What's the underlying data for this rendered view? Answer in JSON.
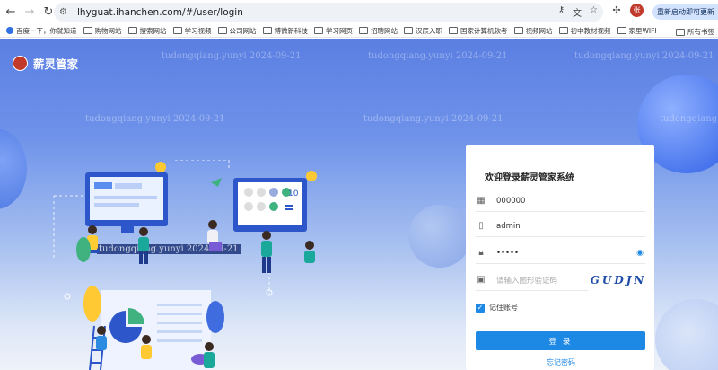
{
  "browser": {
    "url": "lhyguat.ihanchen.com/#/user/login",
    "update_label": "重新启动即可更新",
    "profile_initial": "张"
  },
  "bookmarks": [
    {
      "label": "百度一下，你就知道",
      "type": "site"
    },
    {
      "label": "购物网站",
      "type": "folder"
    },
    {
      "label": "搜索网站",
      "type": "folder"
    },
    {
      "label": "学习视频",
      "type": "folder"
    },
    {
      "label": "公司网站",
      "type": "folder"
    },
    {
      "label": "博微新科技",
      "type": "folder"
    },
    {
      "label": "学习网页",
      "type": "folder"
    },
    {
      "label": "招聘网站",
      "type": "folder"
    },
    {
      "label": "汉辰入职",
      "type": "folder"
    },
    {
      "label": "国家计算机软考",
      "type": "folder"
    },
    {
      "label": "视频网站",
      "type": "folder"
    },
    {
      "label": "初中教材视频",
      "type": "folder"
    },
    {
      "label": "家里WIFI",
      "type": "folder"
    }
  ],
  "bookmarks_all": "所有书签",
  "app": {
    "name": "薪灵管家"
  },
  "watermark": "tudongqiang.yunyi 2024-09-21",
  "login": {
    "title": "欢迎登录薪灵管家系统",
    "company_code": "000000",
    "username": "admin",
    "password_mask": "•••••",
    "captcha_placeholder": "请输入图形验证码",
    "captcha_text": "GUDJN",
    "remember_label": "记住账号",
    "submit_label": "登 录",
    "forgot_label": "忘记密码"
  },
  "colors": {
    "primary": "#1e88e5",
    "brand": "#c0392b"
  }
}
